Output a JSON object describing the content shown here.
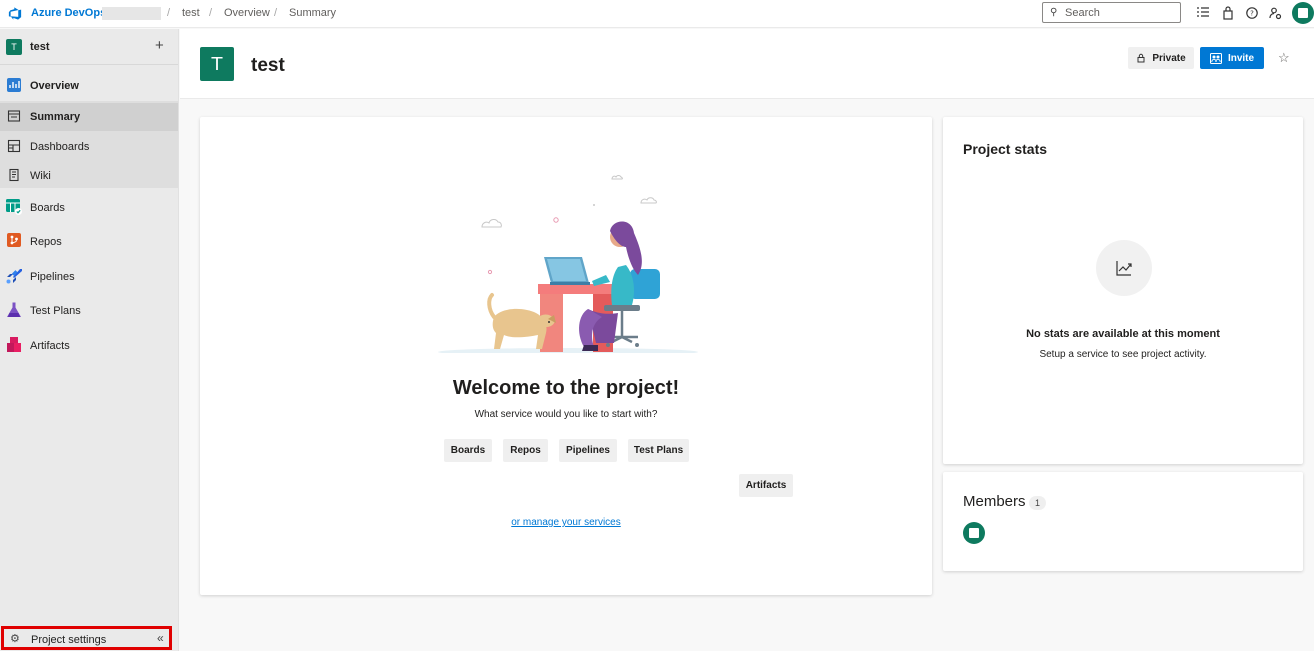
{
  "topbar": {
    "brand": "Azure DevOps",
    "breadcrumbs": [
      "test",
      "Overview",
      "Summary"
    ],
    "search_placeholder": "Search",
    "icons": [
      "task-list-icon",
      "shopping-bag-icon",
      "help-icon",
      "user-settings-icon"
    ]
  },
  "sidebar": {
    "project_initial": "T",
    "project_name": "test",
    "add_label": "+",
    "items": [
      {
        "label": "Overview",
        "icon": "overview-icon"
      },
      {
        "label": "Summary",
        "icon": "summary-icon"
      },
      {
        "label": "Dashboards",
        "icon": "dashboards-icon"
      },
      {
        "label": "Wiki",
        "icon": "wiki-icon"
      },
      {
        "label": "Boards",
        "icon": "boards-icon"
      },
      {
        "label": "Repos",
        "icon": "repos-icon"
      },
      {
        "label": "Pipelines",
        "icon": "pipelines-icon"
      },
      {
        "label": "Test Plans",
        "icon": "test-plans-icon"
      },
      {
        "label": "Artifacts",
        "icon": "artifacts-icon"
      }
    ],
    "settings_label": "Project settings",
    "collapse_glyph": "«"
  },
  "header": {
    "initial": "T",
    "title": "test",
    "private_label": "Private",
    "invite_label": "Invite",
    "favorite_glyph": "☆"
  },
  "welcome": {
    "title": "Welcome to the project!",
    "subtitle": "What service would you like to start with?",
    "services": [
      "Boards",
      "Repos",
      "Pipelines",
      "Test Plans",
      "Artifacts"
    ],
    "manage_link": "or manage your services"
  },
  "stats": {
    "title": "Project stats",
    "message": "No stats are available at this moment",
    "submessage": "Setup a service to see project activity."
  },
  "members": {
    "title": "Members",
    "count": "1"
  },
  "colors": {
    "brand_blue": "#0078d4",
    "project_green": "#0e7a5f",
    "highlight_red": "#e00000"
  }
}
